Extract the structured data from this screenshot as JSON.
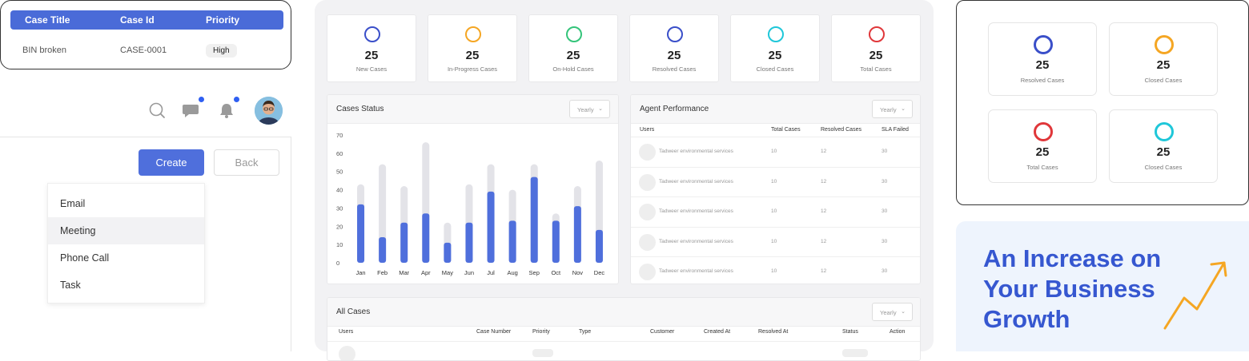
{
  "case_table": {
    "headers": [
      "Case Title",
      "Case Id",
      "Priority"
    ],
    "row": {
      "title": "BIN broken",
      "id": "CASE-0001",
      "priority": "High"
    }
  },
  "topbar": {
    "icons": [
      "search-icon",
      "chat-icon",
      "bell-icon"
    ],
    "avatar": "user-avatar"
  },
  "actions": {
    "create": "Create",
    "back": "Back"
  },
  "dropdown": {
    "items": [
      "Email",
      "Meeting",
      "Phone Call",
      "Task"
    ],
    "active": "Meeting"
  },
  "dashboard": {
    "stats": [
      {
        "num": "25",
        "label": "New Cases",
        "color": "#3a4fc9"
      },
      {
        "num": "25",
        "label": "In-Progress Cases",
        "color": "#f5a623"
      },
      {
        "num": "25",
        "label": "On-Hold Cases",
        "color": "#34c47a"
      },
      {
        "num": "25",
        "label": "Resolved Cases",
        "color": "#3a4fc9"
      },
      {
        "num": "25",
        "label": "Closed Cases",
        "color": "#1fc7d9"
      },
      {
        "num": "25",
        "label": "Total Cases",
        "color": "#e0373a"
      }
    ],
    "cases_status": {
      "title": "Cases Status",
      "filter": "Yearly"
    },
    "agent_performance": {
      "title": "Agent Performance",
      "filter": "Yearly",
      "headers": [
        "Users",
        "Total Cases",
        "Resolved Cases",
        "SLA Failed"
      ],
      "rows": [
        {
          "user": "Tadweer environmental services",
          "total": "10",
          "resolved": "12",
          "sla": "30"
        },
        {
          "user": "Tadweer environmental services",
          "total": "10",
          "resolved": "12",
          "sla": "30"
        },
        {
          "user": "Tadweer environmental services",
          "total": "10",
          "resolved": "12",
          "sla": "30"
        },
        {
          "user": "Tadweer environmental services",
          "total": "10",
          "resolved": "12",
          "sla": "30"
        },
        {
          "user": "Tadweer environmental services",
          "total": "10",
          "resolved": "12",
          "sla": "30"
        }
      ]
    },
    "all_cases": {
      "title": "All Cases",
      "filter": "Yearly",
      "headers": [
        "Users",
        "Case Number",
        "Priority",
        "Type",
        "Customer",
        "Created At",
        "Resolved At",
        "Status",
        "Action"
      ]
    }
  },
  "chart_data": {
    "type": "bar",
    "categories": [
      "Jan",
      "Feb",
      "Mar",
      "Apr",
      "May",
      "Jun",
      "Jul",
      "Aug",
      "Sep",
      "Oct",
      "Nov",
      "Dec"
    ],
    "series": [
      {
        "values": [
          43,
          54,
          42,
          66,
          22,
          43,
          54,
          40,
          54,
          27,
          42,
          56
        ]
      },
      {
        "values": [
          32,
          14,
          22,
          27,
          11,
          22,
          39,
          23,
          47,
          23,
          31,
          18
        ]
      }
    ],
    "ylim": [
      0,
      70
    ],
    "yticks": [
      0,
      10,
      20,
      30,
      40,
      50,
      60,
      70
    ],
    "colors": {
      "background_bar": "#e3e3e8",
      "value_bar": "#4f6fdc"
    }
  },
  "right_stats": [
    {
      "num": "25",
      "label": "Resolved Cases",
      "color": "#3a4fc9"
    },
    {
      "num": "25",
      "label": "Closed Cases",
      "color": "#f5a623"
    },
    {
      "num": "25",
      "label": "Total Cases",
      "color": "#e0373a"
    },
    {
      "num": "25",
      "label": "Closed Cases",
      "color": "#1fc7d9"
    }
  ],
  "growth": {
    "text": "An Increase on Your Business Growth",
    "accent": "#f5a623"
  }
}
